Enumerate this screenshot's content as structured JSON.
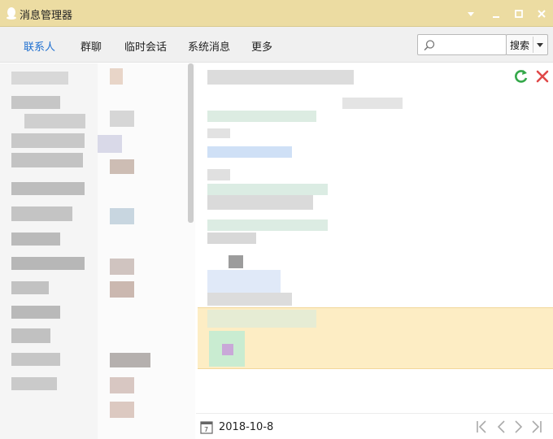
{
  "window": {
    "title": "消息管理器",
    "icon": "qq-penguin-icon",
    "controls": [
      "dropdown-icon",
      "minimize-icon",
      "maximize-icon",
      "close-icon"
    ]
  },
  "tabs": [
    {
      "label": "联系人",
      "active": true
    },
    {
      "label": "群聊",
      "active": false
    },
    {
      "label": "临时会话",
      "active": false
    },
    {
      "label": "系统消息",
      "active": false
    },
    {
      "label": "更多",
      "active": false
    }
  ],
  "search": {
    "value": "",
    "placeholder": "",
    "button_label": "搜索",
    "icon": "search-icon"
  },
  "message_toolbar": {
    "icons": [
      "refresh-icon",
      "delete-icon"
    ]
  },
  "footer": {
    "date": "2018-10-8",
    "icons": [
      "calendar-icon",
      "first-page-icon",
      "prev-page-icon",
      "next-page-icon",
      "last-page-icon"
    ]
  },
  "colors": {
    "titlebar_bg": "#ecdca2",
    "active_tab": "#1e6fd0",
    "highlight_bg": "#fdedc4",
    "refresh_green": "#35a84a",
    "delete_red": "#e04848"
  }
}
